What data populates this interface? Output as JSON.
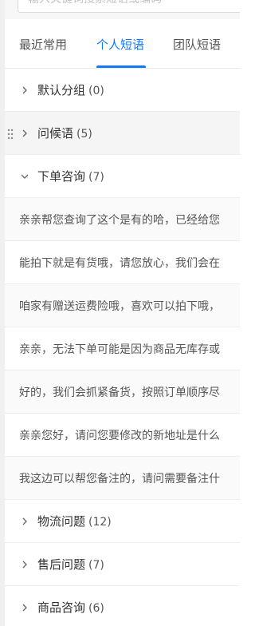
{
  "search": {
    "placeholder": "输入关键词搜索短语或编码"
  },
  "tabs": [
    {
      "label": "最近常用",
      "active": false
    },
    {
      "label": "个人短语",
      "active": true
    },
    {
      "label": "团队短语",
      "active": false
    }
  ],
  "groups": [
    {
      "name": "默认分组",
      "count": "(0)",
      "expanded": false
    },
    {
      "name": "问候语",
      "count": "(5)",
      "expanded": false
    },
    {
      "name": "下单咨询",
      "count": "(7)",
      "expanded": true,
      "phrases": [
        "亲亲帮您查询了这个是有的哈，已经给您",
        "能拍下就是有货哦，请您放心，我们会在",
        "咱家有赠送运费险哦，喜欢可以拍下哦，",
        "亲亲，无法下单可能是因为商品无库存或",
        "好的，我们会抓紧备货，按照订单顺序尽",
        "亲亲您好，请问您要修改的新地址是什么",
        "我这边可以帮您备注的，请问需要备注什"
      ]
    },
    {
      "name": "物流问题",
      "count": "(12)",
      "expanded": false
    },
    {
      "name": "售后问题",
      "count": "(7)",
      "expanded": false
    },
    {
      "name": "商品咨询",
      "count": "(6)",
      "expanded": false
    }
  ],
  "colors": {
    "accent": "#1677ff",
    "text": "#333333",
    "muted": "#555555",
    "divider": "#eeeeee",
    "hover_row": "#f5f5f5"
  },
  "icons": {
    "collapsed": "chevron-right-icon",
    "expanded": "chevron-down-icon",
    "drag": "drag-handle-icon"
  }
}
